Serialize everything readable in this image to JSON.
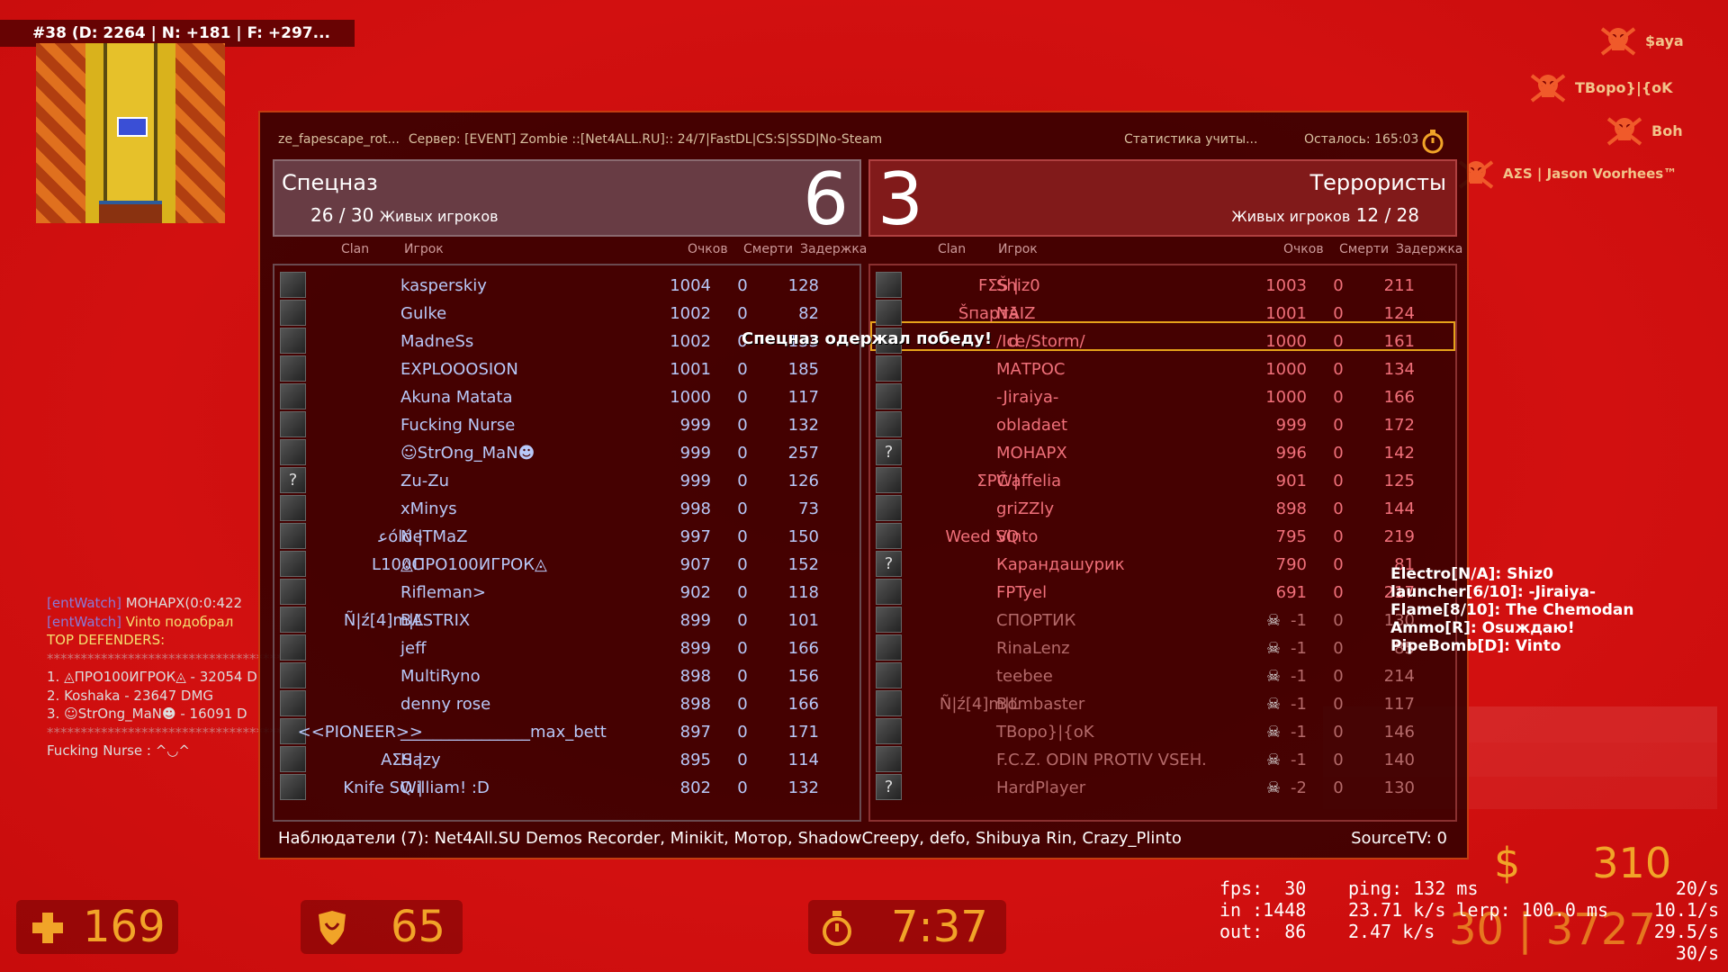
{
  "top_info": "#38 (D: 2264 | N: +181 | F: +297...",
  "killfeed": [
    {
      "name": "$aya"
    },
    {
      "name": "TBopo}|{oK"
    },
    {
      "name": "Boh"
    },
    {
      "name": "AΣS | Jason Voorhees™"
    }
  ],
  "header": {
    "map": "ze_fapescape_rot...",
    "server": "Сервер: [EVENT] Zombie ::[Net4ALL.RU]:: 24/7|FastDL|CS:S|SSD|No-Steam",
    "stats": "Статистика учиты...",
    "remaining": "Осталось: 165:03"
  },
  "ct": {
    "name": "Спецназ",
    "alive_count": "26 / 30",
    "alive_label": "Живых игроков",
    "score": "6",
    "col_clan": "Clan",
    "col_player": "Игрок",
    "col_score": "Очков",
    "col_deaths": "Смерти",
    "col_ping": "Задержка",
    "players": [
      {
        "clan": "",
        "name": "kasperskiy",
        "score": "1004",
        "deaths": "0",
        "ping": "128",
        "av": ""
      },
      {
        "clan": "",
        "name": "Gulke",
        "score": "1002",
        "deaths": "0",
        "ping": "82",
        "av": ""
      },
      {
        "clan": "",
        "name": "MadneSs",
        "score": "1002",
        "deaths": "0",
        "ping": "133",
        "av": ""
      },
      {
        "clan": "",
        "name": "EXPLOOOSION",
        "score": "1001",
        "deaths": "0",
        "ping": "185",
        "av": ""
      },
      {
        "clan": "",
        "name": "Akuna Matata",
        "score": "1000",
        "deaths": "0",
        "ping": "117",
        "av": ""
      },
      {
        "clan": "",
        "name": "Fucking Nurse",
        "score": "999",
        "deaths": "0",
        "ping": "132",
        "av": ""
      },
      {
        "clan": "",
        "name": "☺StrOng_MaN☻",
        "score": "999",
        "deaths": "0",
        "ping": "257",
        "av": ""
      },
      {
        "clan": "",
        "name": "Zu-Zu",
        "score": "999",
        "deaths": "0",
        "ping": "126",
        "av": "?"
      },
      {
        "clan": "",
        "name": "xMinys",
        "score": "998",
        "deaths": "0",
        "ping": "73",
        "av": ""
      },
      {
        "clan": "ﻋóló |",
        "name": "NeTMaZ",
        "score": "997",
        "deaths": "0",
        "ping": "150",
        "av": ""
      },
      {
        "clan": "L100C",
        "name": "◬ПРО100ИГРОК◬",
        "score": "907",
        "deaths": "0",
        "ping": "152",
        "av": ""
      },
      {
        "clan": "",
        "name": "Rifleman>",
        "score": "902",
        "deaths": "0",
        "ping": "118",
        "av": ""
      },
      {
        "clan": "Ñ|ź[4]m|Ľ",
        "name": "BASTRIX",
        "score": "899",
        "deaths": "0",
        "ping": "101",
        "av": ""
      },
      {
        "clan": "",
        "name": "jeff",
        "score": "899",
        "deaths": "0",
        "ping": "166",
        "av": ""
      },
      {
        "clan": "",
        "name": "MultiRyno",
        "score": "898",
        "deaths": "0",
        "ping": "156",
        "av": ""
      },
      {
        "clan": "",
        "name": "denny rose",
        "score": "898",
        "deaths": "0",
        "ping": "166",
        "av": ""
      },
      {
        "clan": "<<PIONEER>>",
        "name": "________________max_bett",
        "score": "897",
        "deaths": "0",
        "ping": "171",
        "av": ""
      },
      {
        "clan": "AΣS |",
        "name": "Hazy",
        "score": "895",
        "deaths": "0",
        "ping": "114",
        "av": ""
      },
      {
        "clan": "Knife SQ |",
        "name": "William! :D",
        "score": "802",
        "deaths": "0",
        "ping": "132",
        "av": ""
      }
    ]
  },
  "t": {
    "name": "Террористы",
    "alive_count": "12 / 28",
    "alive_label": "Живых игроков",
    "score": "3",
    "col_clan": "Clan",
    "col_player": "Игрок",
    "col_score": "Очков",
    "col_deaths": "Смерти",
    "col_ping": "Задержка",
    "players": [
      {
        "clan": "FΣŠ |",
        "name": "Shiz0",
        "score": "1003",
        "deaths": "0",
        "ping": "211",
        "dead": false,
        "av": ""
      },
      {
        "clan": "Šпартā",
        "name": "NAIZ",
        "score": "1001",
        "deaths": "0",
        "ping": "124",
        "dead": false,
        "av": ""
      },
      {
        "clan": "d",
        "name": "/Ice/Storm/",
        "score": "1000",
        "deaths": "0",
        "ping": "161",
        "dead": false,
        "av": ""
      },
      {
        "clan": "",
        "name": "МАТРОС",
        "score": "1000",
        "deaths": "0",
        "ping": "134",
        "dead": false,
        "av": ""
      },
      {
        "clan": "",
        "name": "-Jiraiya-",
        "score": "1000",
        "deaths": "0",
        "ping": "166",
        "dead": false,
        "av": ""
      },
      {
        "clan": "",
        "name": "obladaet",
        "score": "999",
        "deaths": "0",
        "ping": "172",
        "dead": false,
        "av": ""
      },
      {
        "clan": "",
        "name": "МОНАРХ",
        "score": "996",
        "deaths": "0",
        "ping": "142",
        "dead": false,
        "av": "?"
      },
      {
        "clan": "ΣPČ |",
        "name": "Waffelia",
        "score": "901",
        "deaths": "0",
        "ping": "125",
        "dead": false,
        "av": ""
      },
      {
        "clan": "",
        "name": "griZZly",
        "score": "898",
        "deaths": "0",
        "ping": "144",
        "dead": false,
        "av": ""
      },
      {
        "clan": "Weed SQ",
        "name": "Vinto",
        "score": "795",
        "deaths": "0",
        "ping": "219",
        "dead": false,
        "av": ""
      },
      {
        "clan": "",
        "name": "Карандашурик",
        "score": "790",
        "deaths": "0",
        "ping": "81",
        "dead": false,
        "av": "?"
      },
      {
        "clan": "",
        "name": "FPTyel",
        "score": "691",
        "deaths": "0",
        "ping": "217",
        "dead": false,
        "av": ""
      },
      {
        "clan": "",
        "name": "СПОРТИК",
        "score": "-1",
        "deaths": "0",
        "ping": "130",
        "dead": true,
        "av": ""
      },
      {
        "clan": "",
        "name": "RinaLenz",
        "score": "-1",
        "deaths": "0",
        "ping": "85",
        "dead": true,
        "av": ""
      },
      {
        "clan": "",
        "name": "teebee",
        "score": "-1",
        "deaths": "0",
        "ping": "214",
        "dead": true,
        "av": ""
      },
      {
        "clan": "Ñ|ź[4]m|Ľ",
        "name": "Bombaster",
        "score": "-1",
        "deaths": "0",
        "ping": "117",
        "dead": true,
        "av": ""
      },
      {
        "clan": "",
        "name": "TBopo}|{oK",
        "score": "-1",
        "deaths": "0",
        "ping": "146",
        "dead": true,
        "av": ""
      },
      {
        "clan": "",
        "name": "F.C.Z. ODIN PROTIV VSEH.",
        "score": "-1",
        "deaths": "0",
        "ping": "140",
        "dead": true,
        "av": ""
      },
      {
        "clan": "",
        "name": "HardPlayer",
        "score": "-2",
        "deaths": "0",
        "ping": "130",
        "dead": true,
        "av": "?"
      }
    ]
  },
  "victory_text": "Спецназ одержал победу!",
  "spectators": "Наблюдатели (7): Net4All.SU Demos Recorder, Minikit, Мотор, ShadowCreepy, defo, Shibuya Rin, Crazy_Plinto",
  "sourcetv": "SourceTV: 0",
  "left_chat": [
    {
      "tag": "[entWatch]",
      "text": " МОНАРХ(0:0:422",
      "hl": false
    },
    {
      "tag": "[entWatch]",
      "text": " Vinto подобрал",
      "hl": true
    },
    {
      "tag": "",
      "text": "TOP DEFENDERS:",
      "hl": false
    },
    {
      "tag": "",
      "text": "**************************************",
      "hl": false
    },
    {
      "tag": "",
      "text": "1. ◬ПРО100ИГРОК◬ - 32054 D",
      "hl": false
    },
    {
      "tag": "",
      "text": "2. Koshaka - 23647 DMG",
      "hl": false
    },
    {
      "tag": "",
      "text": "3. ☺StrOng_MaN☻ - 16091 D",
      "hl": false
    },
    {
      "tag": "",
      "text": "**************************************",
      "hl": false
    },
    {
      "tag": "",
      "text": "Fucking Nurse : ^◡^",
      "hl": false
    }
  ],
  "right_chat": [
    "Electro[N/A]: Shiz0",
    "launcher[6/10]: -Jiraiya-",
    "Flame[8/10]: The Chemodan",
    "Ammo[R]: Osuждаю!",
    "PipeBomb[D]: Vinto"
  ],
  "hud": {
    "health": "169",
    "armor": "65",
    "timer": "7:37",
    "money_symbol": "$",
    "money": "310",
    "ammo": "30 | 3727"
  },
  "net": {
    "col1": "fps:  30\nin :1448\nout:  86",
    "col2": "ping: 132 ms\n23.71 k/s lerp: 100.0 ms\n2.47 k/s",
    "col3": "20/s\n10.1/s\n29.5/s\n30/s"
  },
  "colors": {
    "accent": "#f1a428",
    "ct_text": "#b8c8f8",
    "t_text": "#f0707a",
    "highlight": "#e6a21a"
  }
}
